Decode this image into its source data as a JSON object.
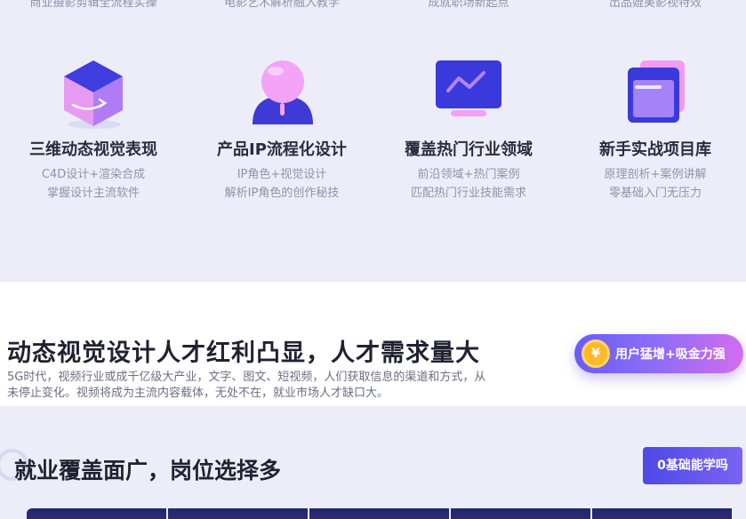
{
  "top_cut_texts": [
    "商业摄影剪辑全流程实操",
    "电影艺术解析融入教学",
    "成就职场新起点",
    "出品媲美影视特效"
  ],
  "features": [
    {
      "title": "三维动态视觉表现",
      "line1": "C4D设计+渲染合成",
      "line2": "掌握设计主流软件",
      "icon": "cube-icon"
    },
    {
      "title": "产品IP流程化设计",
      "line1": "IP角色+视觉设计",
      "line2": "解析IP角色的创作秘技",
      "icon": "character-icon"
    },
    {
      "title": "覆盖热门行业领域",
      "line1": "前沿领域+热门案例",
      "line2": "匹配热门行业技能需求",
      "icon": "monitor-chart-icon"
    },
    {
      "title": "新手实战项目库",
      "line1": "原理剖析+案例讲解",
      "line2": "零基础入门无压力",
      "icon": "window-stack-icon"
    }
  ],
  "banner": {
    "title": "动态视觉设计人才红利凸显，人才需求量大",
    "description": "5G时代，视频行业或成千亿级大产业，文字、图文、短视频，人们获取信息的渠道和方式，从未停止变化。视频将成为主流内容载体，无处不在，就业市场人才缺口大。",
    "pill_coin": "¥",
    "pill_label": "用户猛增+吸金力强"
  },
  "jobs": {
    "title": "就业覆盖面广，岗位选择多",
    "cta_label": "0基础能学吗"
  },
  "colors": {
    "accent": "#5b55ef",
    "pink": "#f08ef5",
    "text_dark": "#1f2230",
    "text_muted": "#8f93a8"
  }
}
